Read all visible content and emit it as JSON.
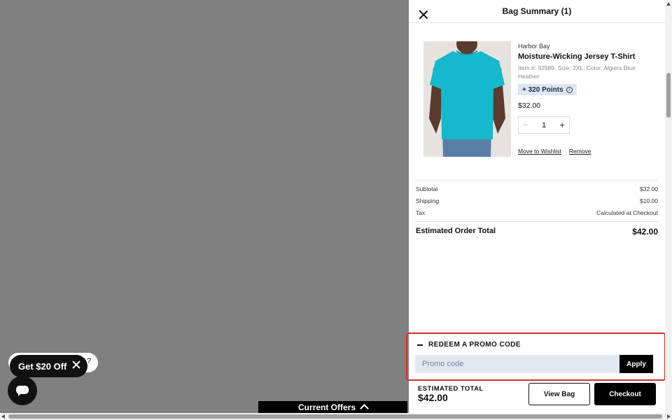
{
  "overlay": {
    "chat_teaser_suffix": "?",
    "promo_pill_label": "Get $20 Off",
    "offers_bar_label": "Current Offers"
  },
  "drawer": {
    "title": "Bag Summary (1)",
    "item": {
      "brand": "Harbor Bay",
      "name": "Moisture-Wicking Jersey T-Shirt",
      "meta": "Item #: 92989, Size: 2XL, Color: Algiers Blue Heather",
      "points": "+ 320 Points",
      "price": "$32.00",
      "quantity": "1",
      "move_to_wishlist": "Move to Wishlist",
      "remove": "Remove"
    },
    "summary": {
      "subtotal_label": "Subtotal",
      "subtotal_value": "$32.00",
      "shipping_label": "Shipping",
      "shipping_value": "$10.00",
      "tax_label": "Tax",
      "tax_value": "Calculated at Checkout",
      "total_label": "Estimated Order Total",
      "total_value": "$42.00"
    },
    "promo": {
      "heading": "REDEEM A PROMO CODE",
      "placeholder": "Promo code",
      "apply_label": "Apply"
    },
    "footer": {
      "estimated_label": "ESTIMATED TOTAL",
      "estimated_value": "$42.00",
      "view_bag_label": "View Bag",
      "checkout_label": "Checkout"
    }
  },
  "colors": {
    "highlight_border": "#d32f2f",
    "shirt": "#16b9cc",
    "points_badge_bg": "#dde7f2",
    "promo_input_bg": "#e2e8f2"
  },
  "icons": [
    "close-icon",
    "info-icon",
    "minus-icon",
    "plus-icon",
    "chat-icon",
    "chevron-up-icon"
  ]
}
